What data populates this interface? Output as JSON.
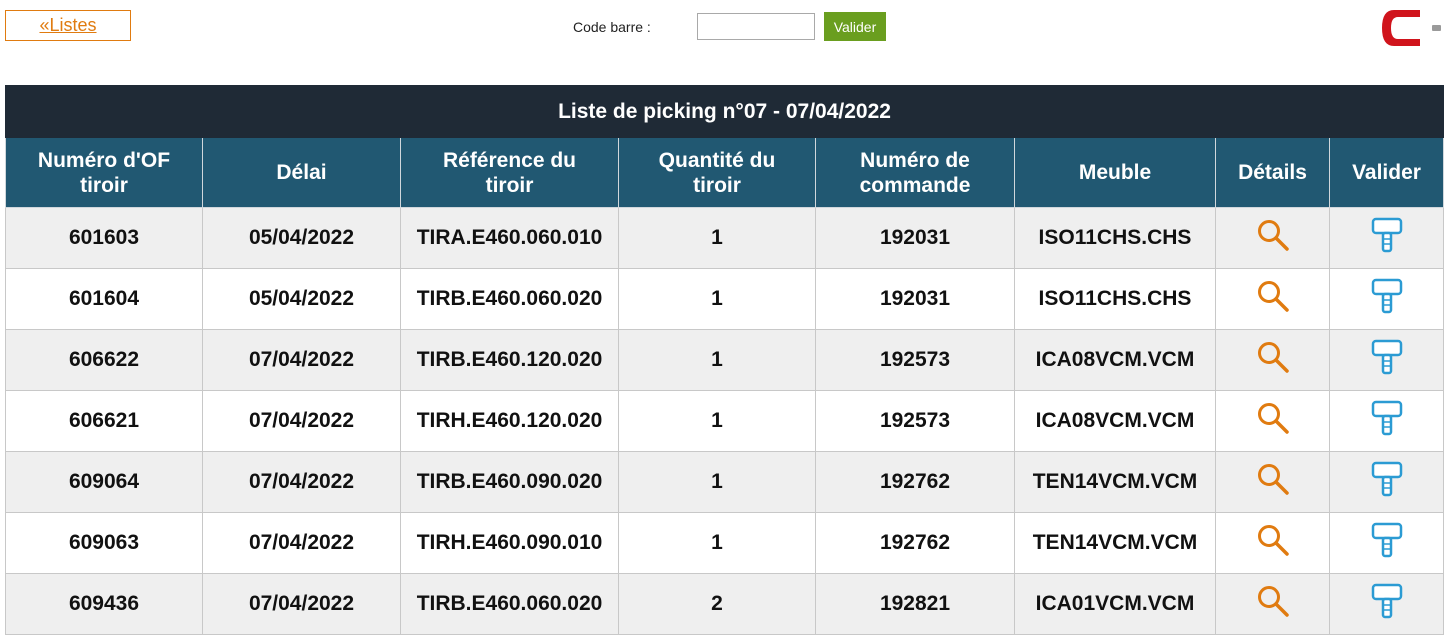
{
  "nav": {
    "back_label": "«Listes"
  },
  "barcode": {
    "label": "Code barre :",
    "value": "",
    "placeholder": "",
    "submit_label": "Valider"
  },
  "logo": {
    "icon": "company-logo-icon",
    "color": "#d0141c"
  },
  "table": {
    "title": "Liste de picking n°07 - 07/04/2022",
    "columns": [
      [
        "Numéro d'OF",
        "tiroir"
      ],
      [
        "Délai"
      ],
      [
        "Référence du",
        "tiroir"
      ],
      [
        "Quantité du",
        "tiroir"
      ],
      [
        "Numéro de",
        "commande"
      ],
      [
        "Meuble"
      ],
      [
        "Détails"
      ],
      [
        "Valider"
      ]
    ],
    "rows": [
      {
        "of": "601603",
        "delai": "05/04/2022",
        "ref": "TIRA.E460.060.010",
        "qty": "1",
        "cmd": "192031",
        "meuble": "ISO11CHS.CHS"
      },
      {
        "of": "601604",
        "delai": "05/04/2022",
        "ref": "TIRB.E460.060.020",
        "qty": "1",
        "cmd": "192031",
        "meuble": "ISO11CHS.CHS"
      },
      {
        "of": "606622",
        "delai": "07/04/2022",
        "ref": "TIRB.E460.120.020",
        "qty": "1",
        "cmd": "192573",
        "meuble": "ICA08VCM.VCM"
      },
      {
        "of": "606621",
        "delai": "07/04/2022",
        "ref": "TIRH.E460.120.020",
        "qty": "1",
        "cmd": "192573",
        "meuble": "ICA08VCM.VCM"
      },
      {
        "of": "609064",
        "delai": "07/04/2022",
        "ref": "TIRB.E460.090.020",
        "qty": "1",
        "cmd": "192762",
        "meuble": "TEN14VCM.VCM"
      },
      {
        "of": "609063",
        "delai": "07/04/2022",
        "ref": "TIRH.E460.090.010",
        "qty": "1",
        "cmd": "192762",
        "meuble": "TEN14VCM.VCM"
      },
      {
        "of": "609436",
        "delai": "07/04/2022",
        "ref": "TIRB.E460.060.020",
        "qty": "2",
        "cmd": "192821",
        "meuble": "ICA01VCM.VCM"
      }
    ],
    "details_icon": "magnifier-icon",
    "validate_icon": "hammer-icon",
    "colors": {
      "title_bg": "#1f2a36",
      "header_bg": "#215872",
      "details_icon": "#e07b10",
      "validate_icon": "#2b9bd3"
    }
  }
}
